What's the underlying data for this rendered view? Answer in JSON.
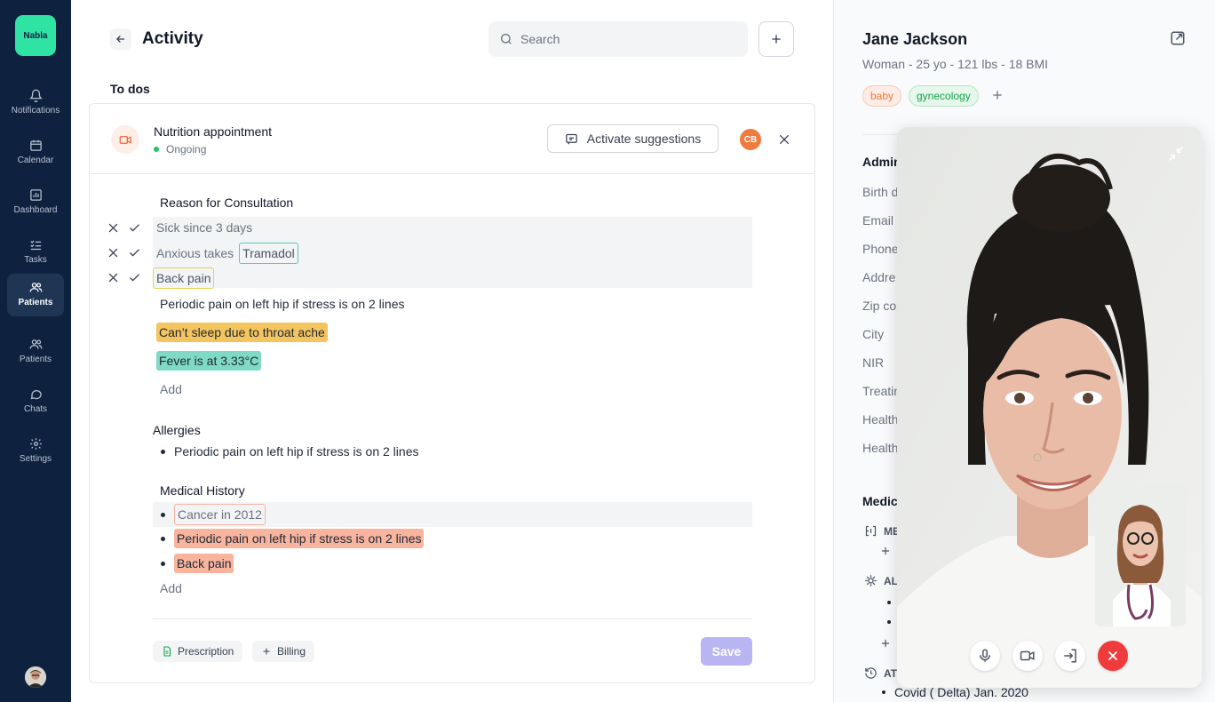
{
  "sidebar": {
    "logo": "Nabla",
    "items": [
      {
        "label": "Notifications",
        "icon": "bell-icon"
      },
      {
        "label": "Calendar",
        "icon": "calendar-icon"
      },
      {
        "label": "Dashboard",
        "icon": "chart-icon"
      },
      {
        "label": "Tasks",
        "icon": "tasks-icon"
      },
      {
        "label": "Patients",
        "icon": "users-icon",
        "active": true
      },
      {
        "label": "Patients",
        "icon": "users-icon"
      },
      {
        "label": "Chats",
        "icon": "chat-icon"
      },
      {
        "label": "Settings",
        "icon": "gear-icon"
      }
    ]
  },
  "header": {
    "title": "Activity",
    "search_placeholder": "Search"
  },
  "todos_label": "To dos",
  "appointment": {
    "title": "Nutrition appointment",
    "status": "Ongoing",
    "activate_label": "Activate suggestions",
    "assignee_initials": "CB"
  },
  "consultation": {
    "heading": "Reason for Consultation",
    "suggestions": [
      {
        "text": "Sick since 3 days"
      },
      {
        "text": "Anxious takes",
        "chip": "Tramadol"
      },
      {
        "chip": "Back pain"
      }
    ],
    "lines": [
      "Periodic pain on left hip if stress is on 2 lines",
      "Can’t sleep due to throat ache",
      "Fever is at 3.33°C"
    ],
    "add_label": "Add"
  },
  "allergies": {
    "heading": "Allergies",
    "items": [
      "Periodic pain on left hip if stress is on 2 lines"
    ]
  },
  "history": {
    "heading": "Medical History",
    "items": [
      "Cancer in 2012",
      "Periodic pain on left hip if stress is on 2 lines",
      "Back pain"
    ],
    "add_label": "Add"
  },
  "footer": {
    "prescription_label": "Prescription",
    "billing_label": "Billing",
    "save_label": "Save"
  },
  "patient": {
    "name": "Jane Jackson",
    "meta": "Woman - 25 yo - 121 lbs - 18 BMI",
    "tags": [
      "baby",
      "gynecology"
    ],
    "admin_heading": "Admin",
    "fields": [
      "Birth d",
      "Email",
      "Phone",
      "Addre",
      "Zip co",
      "City",
      "NIR",
      "Treatin",
      "Health",
      "Health"
    ],
    "medical_heading": "Medic",
    "sub_me": "ME",
    "sub_al": "AL",
    "sub_at": "AT",
    "last_item": "Covid ( Delta) Jan. 2020"
  },
  "colors": {
    "sidebar_bg": "#0e2240",
    "accent_green": "#2fe3a3",
    "hangup": "#ef3b3b",
    "save_disabled": "#b8b5f2"
  }
}
